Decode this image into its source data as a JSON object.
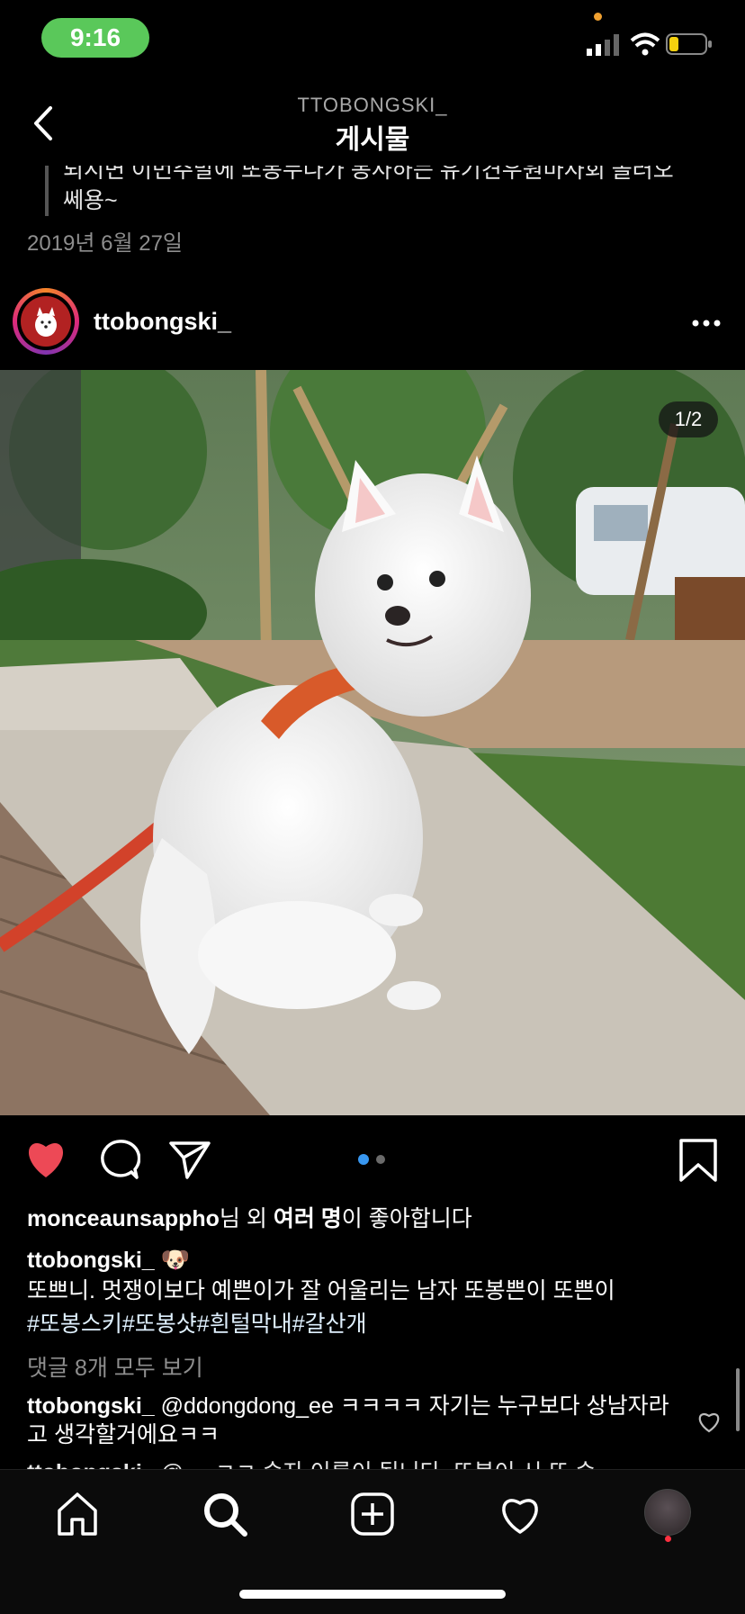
{
  "status": {
    "time": "9:16"
  },
  "header": {
    "username": "TTOBONGSKI_",
    "title": "게시물"
  },
  "previous_post": {
    "caption_tail": "되시면 이번주말에 또봉누나가 봉사하는 유기견우원마사회 놀러오쎄용~",
    "date": "2019년 6월 27일"
  },
  "post": {
    "username": "ttobongski_",
    "image_counter": "1/2",
    "carousel": {
      "total": 2,
      "current": 1
    },
    "likes": {
      "first_user": "monceaunsappho",
      "mid1": "님 외 ",
      "others": "여러 명",
      "mid2": "이 좋아합니다"
    },
    "caption": {
      "username": "ttobongski_",
      "emoji": "🐶",
      "text": "또쁘니. 멋쟁이보다 예쁜이가 잘 어울리는 남자 또봉쁜이 또쁜이",
      "hashtags": "#또봉스키#또봉샷#흰털막내#갈산개"
    },
    "view_all_comments": "댓글 8개 모두 보기",
    "comments": [
      {
        "username": "ttobongski_",
        "text": "@ddongdong_ee ㅋㅋㅋㅋ 자기는 누구보다 상남자라고 생각할거에요ㅋㅋ"
      },
      {
        "username": "ttobongski_",
        "text": "@ ... ㅋㅋ 숫자 이름이 됩니다. 또봉이 시 또 숫"
      }
    ]
  },
  "colors": {
    "heart": "#ed4956",
    "accent": "#3897f0",
    "background": "#000000"
  },
  "icons": [
    "back-chevron-icon",
    "more-icon",
    "heart-icon",
    "comment-icon",
    "share-icon",
    "bookmark-icon",
    "home-icon",
    "search-icon",
    "add-post-icon",
    "activity-icon",
    "profile-avatar"
  ]
}
